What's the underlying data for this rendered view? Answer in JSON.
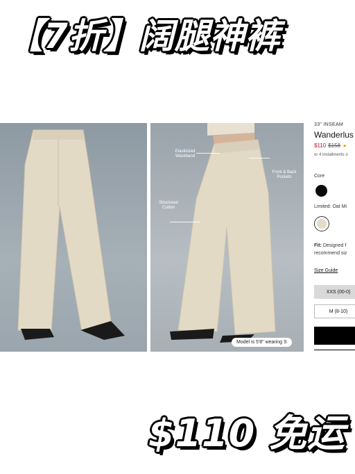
{
  "banner": {
    "top_text": "【7折】阔腿神裤",
    "bottom_text": "$110 免运"
  },
  "gallery": {
    "callouts": {
      "waistband": "Elasticized\nWaistband",
      "pockets": "Front & Back\nPockets",
      "cotton": "Structured\nCotton"
    },
    "model_note": "Model is 5'8\" wearing S"
  },
  "product": {
    "inseam": "33\" INSEAM",
    "name": "Wanderlus",
    "price_now": "$110",
    "price_old": "$158",
    "stars": "★",
    "installments": "or 4 installments o",
    "core_label": "Core",
    "limited_label": "Limited: Oat Mi",
    "fit_label": "Fit:",
    "fit_text": "Designed f",
    "fit_text_2": "recommend siz",
    "size_guide": "Size Guide",
    "sizes": [
      "XXS (00-0)",
      "M (8-10)"
    ]
  },
  "colors": {
    "sale_red": "#c8102e",
    "swatch_black": "#0a0a0a",
    "swatch_oat": "#e4dbc8"
  }
}
